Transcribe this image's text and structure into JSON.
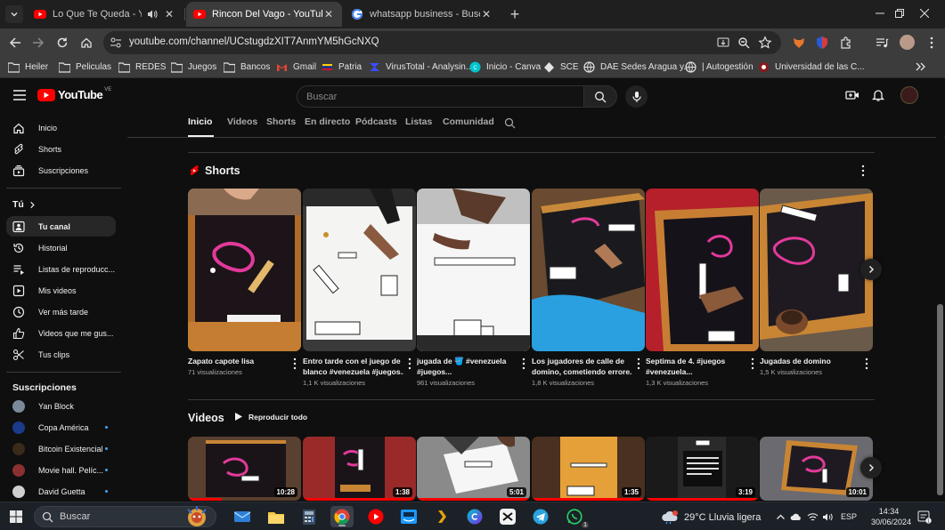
{
  "browser": {
    "tabs": [
      {
        "title": "Lo Que Te Queda - YouTube",
        "active": false
      },
      {
        "title": "Rincon Del Vago - YouTube",
        "active": true
      },
      {
        "title": "whatsapp business - Buscar con Google",
        "active": false
      }
    ],
    "url": "youtube.com/channel/UCstugdzXIT7AnmYM5hGcNXQ",
    "bookmarks": [
      "Heiler",
      "Peliculas",
      "REDES",
      "Juegos",
      "Bancos",
      "Gmail",
      "Patria",
      "VirusTotal - Analysin...",
      "Inicio - Canva",
      "SCE",
      "DAE Sedes Aragua y...",
      "| Autogestión",
      "Universidad de las C..."
    ]
  },
  "youtube": {
    "logo_text": "YouTube",
    "country_code": "VE",
    "search_placeholder": "Buscar",
    "sidebar": {
      "main": [
        {
          "label": "Inicio",
          "icon": "home-icon"
        },
        {
          "label": "Shorts",
          "icon": "shorts-icon"
        },
        {
          "label": "Suscripciones",
          "icon": "subscriptions-icon"
        }
      ],
      "you_heading": "Tú",
      "you": [
        {
          "label": "Tu canal",
          "icon": "channel-icon",
          "active": true
        },
        {
          "label": "Historial",
          "icon": "history-icon"
        },
        {
          "label": "Listas de reproducc...",
          "icon": "playlists-icon"
        },
        {
          "label": "Mis videos",
          "icon": "my-videos-icon"
        },
        {
          "label": "Ver más tarde",
          "icon": "watch-later-icon"
        },
        {
          "label": "Videos que me gus...",
          "icon": "liked-icon"
        },
        {
          "label": "Tus clips",
          "icon": "clips-icon"
        }
      ],
      "subs_heading": "Suscripciones",
      "subscriptions": [
        {
          "label": "Yan Block",
          "color": "#7a8a9a",
          "new": false
        },
        {
          "label": "Copa América",
          "color": "#1a3a8a",
          "new": true
        },
        {
          "label": "Bitcoin Existencial",
          "color": "#3a2a1a",
          "new": true
        },
        {
          "label": "Movie hall. Pelíc...",
          "color": "#8a3030",
          "new": true
        },
        {
          "label": "David Guetta",
          "color": "#cfcfcf",
          "new": true
        }
      ]
    },
    "channel_tabs": [
      "Inicio",
      "Videos",
      "Shorts",
      "En directo",
      "Pódcasts",
      "Listas",
      "Comunidad"
    ],
    "shorts_heading": "Shorts",
    "shorts": [
      {
        "title_lines": [
          "Zapato capote lisa"
        ],
        "views": "71 visualizaciones"
      },
      {
        "title_lines": [
          "Entro tarde con el juego de",
          "blanco #venezuela #juegos..."
        ],
        "views": "1,1 K visualizaciones"
      },
      {
        "title_lines": [
          "jugada de 🪣 #venezuela",
          "#juegos..."
        ],
        "views": "961 visualizaciones"
      },
      {
        "title_lines": [
          "Los jugadores de calle de",
          "domino, cometiendo errore..."
        ],
        "views": "1,8 K visualizaciones"
      },
      {
        "title_lines": [
          "Septima de 4. #juegos",
          "#venezuela..."
        ],
        "views": "1,3 K visualizaciones"
      },
      {
        "title_lines": [
          "Jugadas de domino"
        ],
        "views": "1,5 K visualizaciones"
      }
    ],
    "videos_heading": "Videos",
    "play_all": "Reproducir todo",
    "videos": [
      {
        "duration": "10:28",
        "progress": 0.3
      },
      {
        "duration": "1:38",
        "progress": 1.0
      },
      {
        "duration": "5:01",
        "progress": 1.0
      },
      {
        "duration": "1:35",
        "progress": 1.0
      },
      {
        "duration": "3:19",
        "progress": 1.0
      },
      {
        "duration": "10:01",
        "progress": 0.0
      }
    ]
  },
  "taskbar": {
    "search_label": "Buscar",
    "weather": "29°C  Lluvia ligera",
    "weather_badge": "1",
    "language": "ESP",
    "time": "14:34",
    "date": "30/06/2024",
    "notification_count": "1"
  }
}
